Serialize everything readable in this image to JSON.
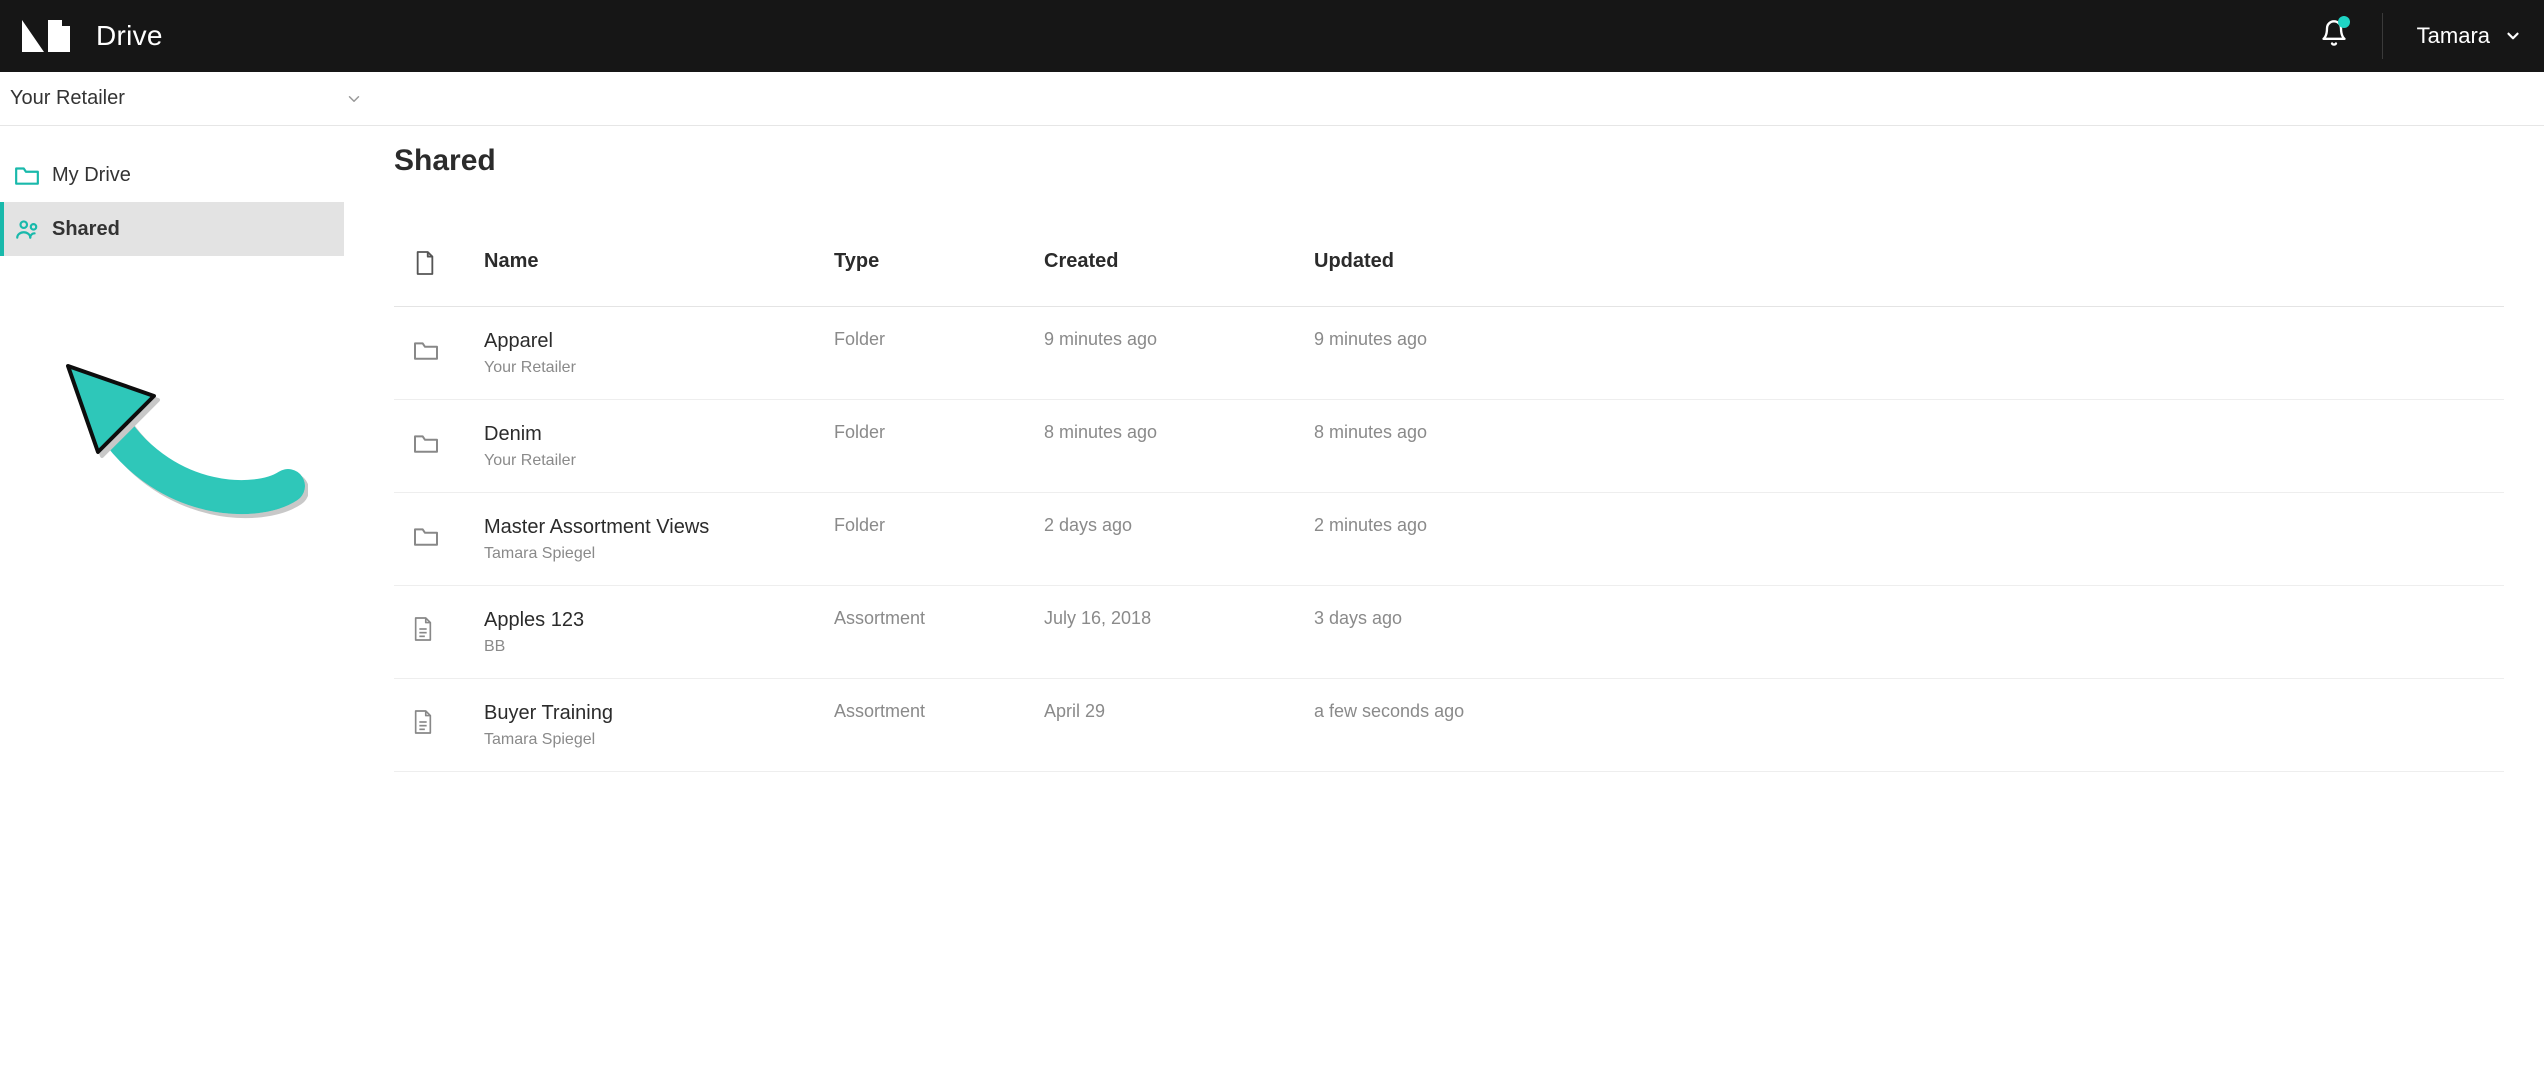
{
  "header": {
    "app_title": "Drive",
    "user_name": "Tamara"
  },
  "retailer_bar": {
    "selected": "Your Retailer"
  },
  "sidebar": {
    "items": [
      {
        "label": "My Drive",
        "active": false
      },
      {
        "label": "Shared",
        "active": true
      }
    ]
  },
  "main": {
    "page_title": "Shared",
    "columns": {
      "name": "Name",
      "type": "Type",
      "created": "Created",
      "updated": "Updated"
    },
    "rows": [
      {
        "icon": "folder",
        "title": "Apparel",
        "subtitle": "Your Retailer",
        "type": "Folder",
        "created": "9 minutes ago",
        "updated": "9 minutes ago"
      },
      {
        "icon": "folder",
        "title": "Denim",
        "subtitle": "Your Retailer",
        "type": "Folder",
        "created": "8 minutes ago",
        "updated": "8 minutes ago"
      },
      {
        "icon": "folder",
        "title": "Master Assortment Views",
        "subtitle": "Tamara Spiegel",
        "type": "Folder",
        "created": "2 days ago",
        "updated": "2 minutes ago"
      },
      {
        "icon": "doc",
        "title": "Apples 123",
        "subtitle": "BB",
        "type": "Assortment",
        "created": "July 16, 2018",
        "updated": "3 days ago"
      },
      {
        "icon": "doc",
        "title": "Buyer Training",
        "subtitle": "Tamara Spiegel",
        "type": "Assortment",
        "created": "April 29",
        "updated": "a few seconds ago"
      }
    ]
  }
}
